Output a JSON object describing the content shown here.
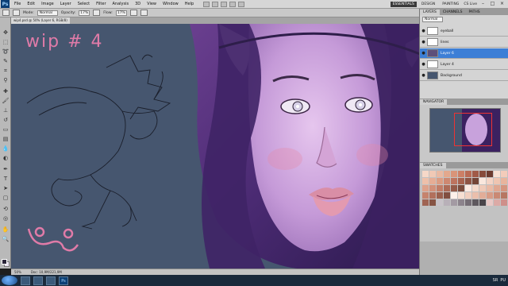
{
  "menubar": {
    "app_logo": "Ps",
    "menus": [
      "File",
      "Edit",
      "Image",
      "Layer",
      "Select",
      "Filter",
      "Analysis",
      "3D",
      "View",
      "Window",
      "Help"
    ],
    "workspaces": [
      "ESSENTIALS",
      "DESIGN",
      "PAINTING"
    ],
    "cs_live": "CS Live"
  },
  "options": {
    "mode_label": "Mode:",
    "mode_value": "Normal",
    "opacity_label": "Opacity:",
    "opacity_value": "17%",
    "flow_label": "Flow:",
    "flow_value": "17%"
  },
  "document": {
    "tab_title": "wip4.psd @ 50% (Layer 6, RGB/8)",
    "artwork_text": "wip # 4",
    "status_zoom": "50%",
    "status_doc": "Doc: 10,9M/221,9M"
  },
  "layers_panel": {
    "tabs": [
      "LAYERS",
      "CHANNELS",
      "PATHS"
    ],
    "blend_mode": "Normal",
    "layers": [
      {
        "name": "eyeball",
        "selected": false
      },
      {
        "name": "lines",
        "selected": false
      },
      {
        "name": "Layer 6",
        "selected": true
      },
      {
        "name": "Layer 4",
        "selected": false
      },
      {
        "name": "Background",
        "selected": false
      }
    ]
  },
  "navigator_panel": {
    "tab": "NAVIGATOR"
  },
  "swatches_panel": {
    "tab": "SWATCHES",
    "colors": [
      "#f6d8c8",
      "#f1c9b5",
      "#eab9a2",
      "#e3a88d",
      "#d99479",
      "#cc7f66",
      "#b96a54",
      "#a15a47",
      "#874b3b",
      "#6d3c30",
      "#f8e0d3",
      "#f3ccba",
      "#eec0aa",
      "#e6ad95",
      "#dc9c82",
      "#ce8871",
      "#bd745f",
      "#a8634f",
      "#8e5444",
      "#744537",
      "#f9e7dd",
      "#f4d3c4",
      "#efc5b1",
      "#e8b49d",
      "#dea28b",
      "#d29079",
      "#c27d67",
      "#ad6b57",
      "#955b49",
      "#7a4b3c",
      "#fbebe3",
      "#f5d9cb",
      "#efc9b7",
      "#e9b9a4",
      "#e0a791",
      "#d5957f",
      "#c6836d",
      "#b2705c",
      "#9b604e",
      "#814f40",
      "#fdf1ea",
      "#f7dfd2",
      "#f1cfbf",
      "#ebbfac",
      "#e2ad98",
      "#d89b86",
      "#ca8974",
      "#b77662",
      "#a06453",
      "#875444",
      "#c8c2c8",
      "#b8b0b8",
      "#a39aa3",
      "#8c838c",
      "#756d75",
      "#5e585e",
      "#4a454a",
      "#e9c8c5",
      "#dcaaa6",
      "#cf8f8a"
    ]
  },
  "taskbar": {
    "language": "SR",
    "layout": "PU"
  }
}
